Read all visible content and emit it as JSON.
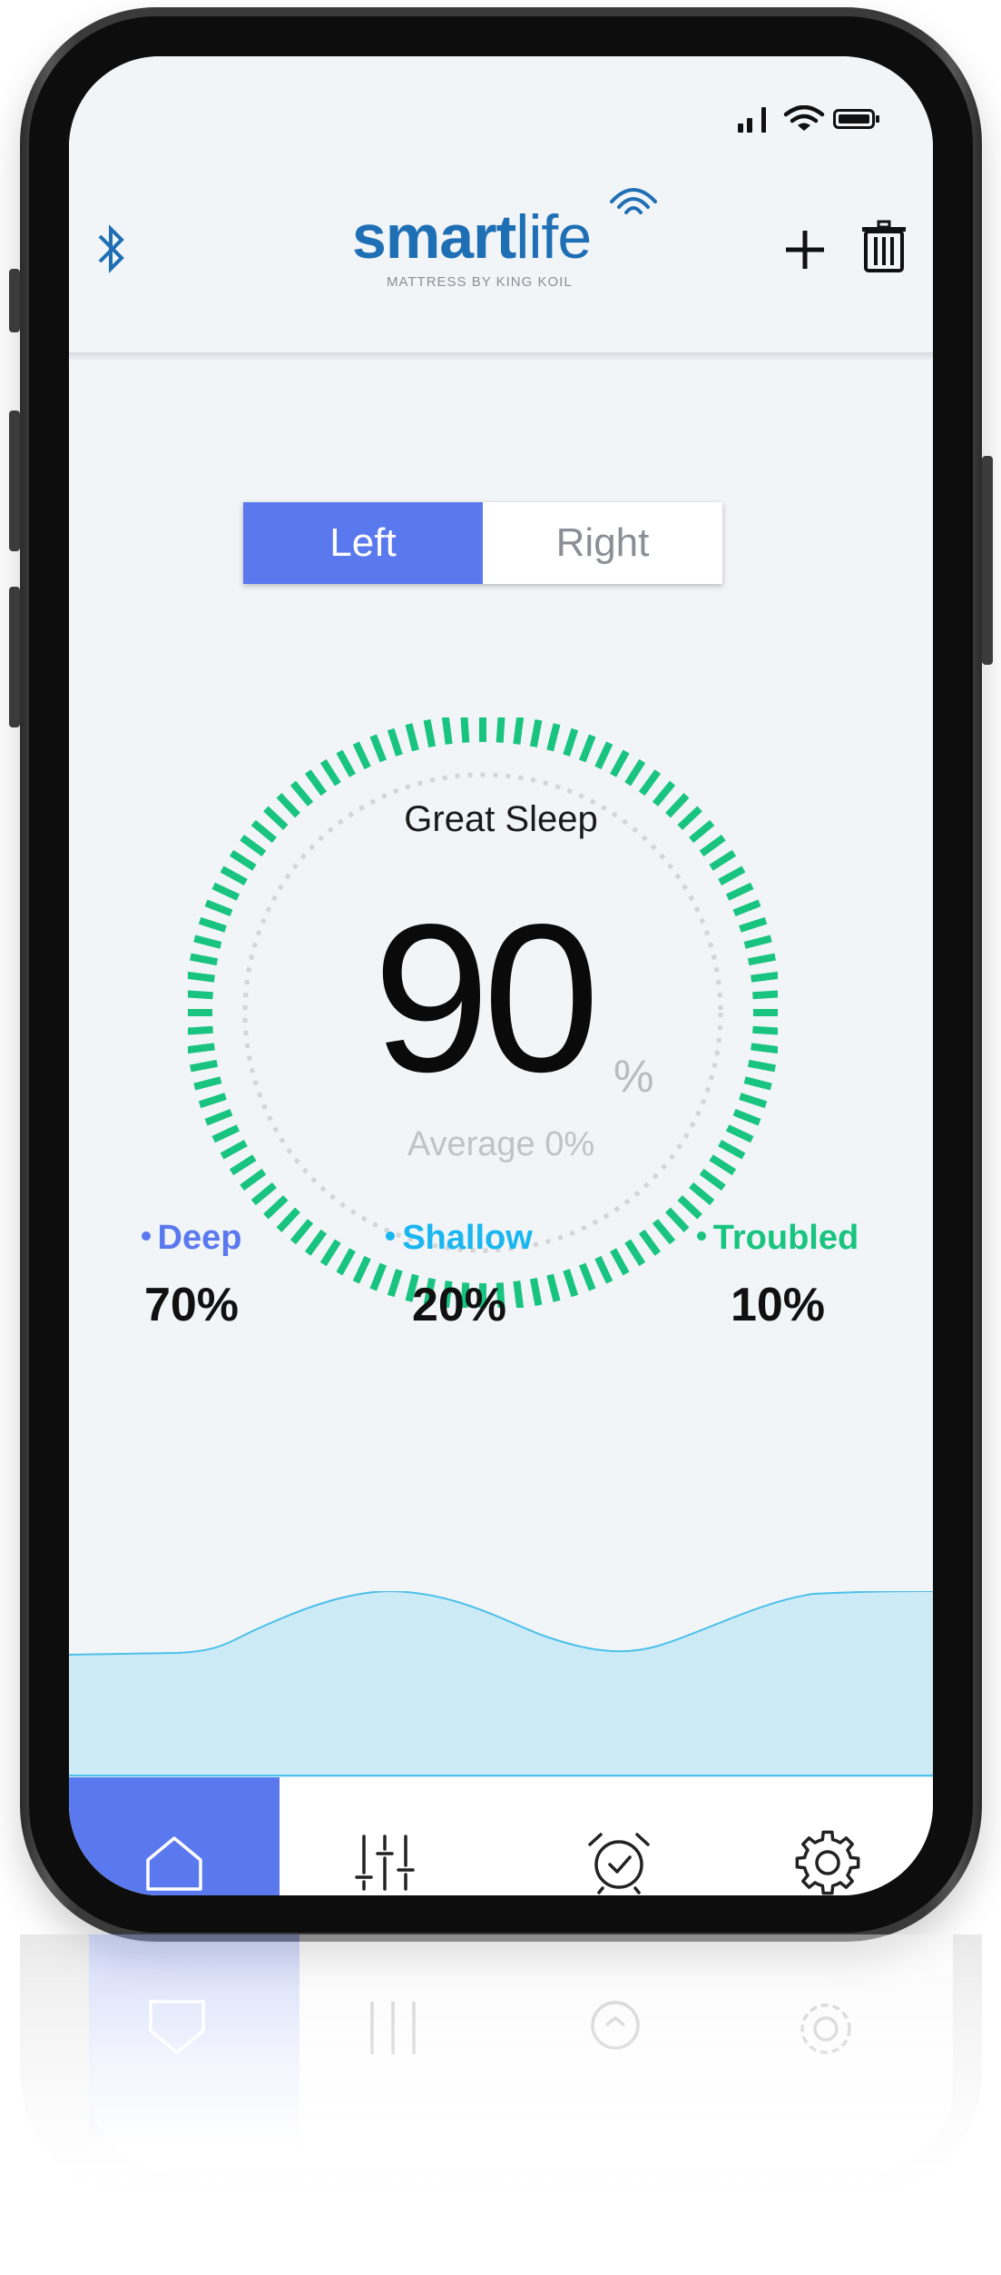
{
  "app": {
    "logo_brand_bold": "smart",
    "logo_brand_light": "life",
    "logo_tagline": "MATTRESS BY KING KOIL",
    "accent_color": "#5b79ef",
    "brand_color": "#1f6fb5"
  },
  "header": {
    "bluetooth_icon": "bluetooth-icon",
    "add_icon": "plus-icon",
    "delete_icon": "trash-icon"
  },
  "side_toggle": {
    "left_label": "Left",
    "right_label": "Right",
    "selected": "Left"
  },
  "gauge": {
    "title": "Great Sleep",
    "value": "90",
    "unit": "%",
    "average_label": "Average 0%",
    "fraction": 0.9,
    "color": "#18c47f"
  },
  "stats": [
    {
      "label": "Deep",
      "value": "70%",
      "color": "#5b79ef"
    },
    {
      "label": "Shallow",
      "value": "20%",
      "color": "#19b6f0"
    },
    {
      "label": "Troubled",
      "value": "10%",
      "color": "#18c47f"
    }
  ],
  "nav": {
    "items": [
      {
        "icon": "home-icon",
        "active": true
      },
      {
        "icon": "sliders-icon",
        "active": false
      },
      {
        "icon": "alarm-clock-icon",
        "active": false
      },
      {
        "icon": "gear-icon",
        "active": false
      }
    ]
  }
}
